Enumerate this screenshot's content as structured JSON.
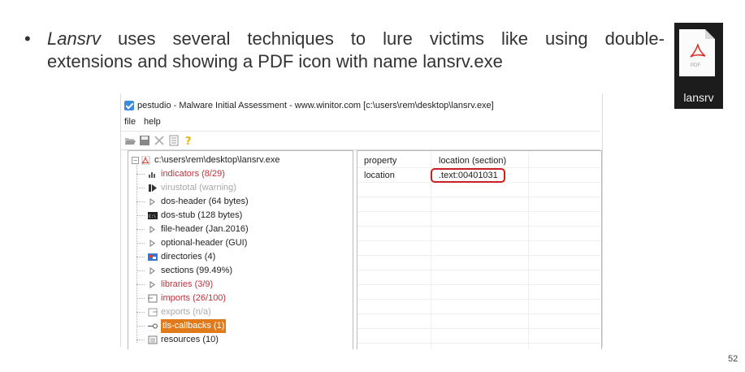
{
  "slide": {
    "bullet_symbol": "•",
    "bullet_italic": "Lansrv",
    "bullet_line1_rest": " uses several techniques to lure victims like using double-",
    "bullet_line2": "extensions and showing a PDF icon with name lansrv.exe",
    "page_number": "52"
  },
  "pdf_icon": {
    "small_label": "PDF",
    "file_name": "lansrv",
    "mark_color": "#d9342b"
  },
  "app": {
    "title": "pestudio - Malware Initial Assessment - www.winitor.com [c:\\users\\rem\\desktop\\lansrv.exe]",
    "menu": [
      "file",
      "help"
    ],
    "toolbar_icons": [
      "open-icon",
      "save-icon",
      "close-icon",
      "list-icon",
      "help-icon"
    ],
    "tree": [
      {
        "label": "c:\\users\\rem\\desktop\\lansrv.exe",
        "color": "black",
        "icon": "pdf-file-icon",
        "root": true
      },
      {
        "label": "indicators (8/29)",
        "color": "red",
        "icon": "bar-chart-icon"
      },
      {
        "label": "virustotal (warning)",
        "color": "grey",
        "icon": "play-arrow-icon"
      },
      {
        "label": "dos-header (64 bytes)",
        "color": "black",
        "icon": "triangle-icon"
      },
      {
        "label": "dos-stub (128 bytes)",
        "color": "black",
        "icon": "console-icon"
      },
      {
        "label": "file-header (Jan.2016)",
        "color": "black",
        "icon": "triangle-icon"
      },
      {
        "label": "optional-header (GUI)",
        "color": "black",
        "icon": "triangle-icon"
      },
      {
        "label": "directories (4)",
        "color": "black",
        "icon": "directory-icon"
      },
      {
        "label": "sections (99.49%)",
        "color": "black",
        "icon": "triangle-icon"
      },
      {
        "label": "libraries (3/9)",
        "color": "red",
        "icon": "triangle-icon"
      },
      {
        "label": "imports (26/100)",
        "color": "red",
        "icon": "import-icon"
      },
      {
        "label": "exports (n/a)",
        "color": "grey",
        "icon": "export-icon"
      },
      {
        "label": "tls-callbacks (1)",
        "color": "selected",
        "icon": "key-icon"
      },
      {
        "label": "resources (10)",
        "color": "black",
        "icon": "resource-icon"
      }
    ],
    "properties": {
      "headers": [
        "property",
        "location (section)"
      ],
      "rows": [
        [
          "location",
          ".text:00401031"
        ]
      ]
    }
  }
}
